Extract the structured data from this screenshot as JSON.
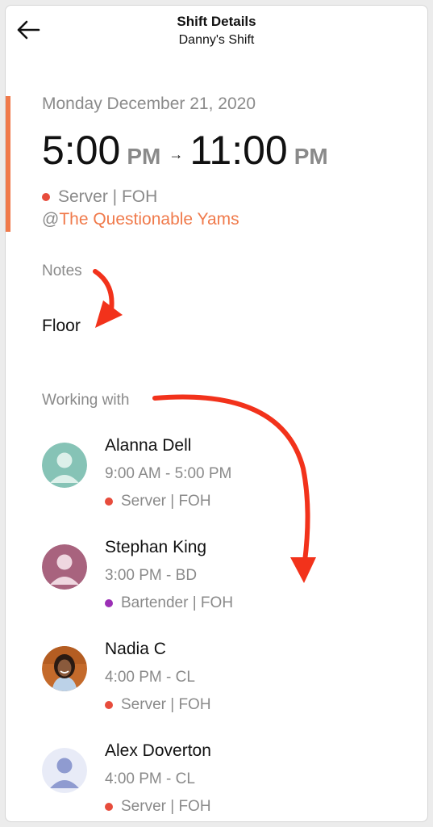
{
  "header": {
    "title": "Shift Details",
    "subtitle": "Danny's Shift",
    "back_icon": "arrow-left-icon"
  },
  "shift": {
    "date": "Monday December 21, 2020",
    "start_time": "5:00",
    "start_ampm": "PM",
    "end_time": "11:00",
    "end_ampm": "PM",
    "arrow": "→",
    "role": "Server | FOH",
    "role_color": "#e74c3c",
    "at_sign": "@",
    "location": "The Questionable Yams",
    "accent_color": "#f07a4b"
  },
  "notes": {
    "label": "Notes",
    "text": "Floor"
  },
  "working_with": {
    "label": "Working with",
    "people": [
      {
        "name": "Alanna Dell",
        "time": "9:00 AM - 5:00 PM",
        "role": "Server | FOH",
        "role_color": "#e74c3c",
        "avatar_color": "#86c3b6"
      },
      {
        "name": "Stephan King",
        "time": "3:00 PM - BD",
        "role": "Bartender | FOH",
        "role_color": "#9b2fb5",
        "avatar_color": "#a8637e"
      },
      {
        "name": "Nadia C",
        "time": "4:00 PM - CL",
        "role": "Server | FOH",
        "role_color": "#e74c3c",
        "avatar_color": "#c46a2b"
      },
      {
        "name": "Alex Doverton",
        "time": "4:00 PM - CL",
        "role": "Server | FOH",
        "role_color": "#e74c3c",
        "avatar_color": "#e8ebf7"
      }
    ]
  },
  "annotations": {
    "arrow_color": "#f2321b"
  }
}
